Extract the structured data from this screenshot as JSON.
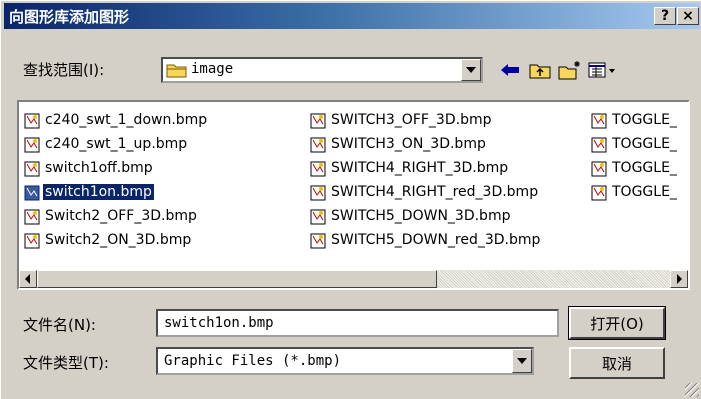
{
  "window": {
    "title": "向图形库添加图形",
    "help_label": "?",
    "close_label": "×"
  },
  "lookin": {
    "label": "查找范围(I):",
    "value": "image"
  },
  "files": {
    "column1": [
      "c240_swt_1_down.bmp",
      "c240_swt_1_up.bmp",
      "switch1off.bmp",
      "switch1on.bmp",
      "Switch2_OFF_3D.bmp",
      "Switch2_ON_3D.bmp"
    ],
    "column2": [
      "SWITCH3_OFF_3D.bmp",
      "SWITCH3_ON_3D.bmp",
      "SWITCH4_RIGHT_3D.bmp",
      "SWITCH4_RIGHT_red_3D.bmp",
      "SWITCH5_DOWN_3D.bmp",
      "SWITCH5_DOWN_red_3D.bmp"
    ],
    "column3": [
      "TOGGLE_",
      "TOGGLE_",
      "TOGGLE_",
      "TOGGLE_"
    ],
    "selected": "switch1on.bmp"
  },
  "filename": {
    "label": "文件名(N):",
    "value": "switch1on.bmp"
  },
  "filetype": {
    "label": "文件类型(T):",
    "value": "Graphic Files (*.bmp)"
  },
  "buttons": {
    "open": "打开(O)",
    "cancel": "取消"
  },
  "colors": {
    "titlebar_start": "#0a246a",
    "titlebar_end": "#a6caf0",
    "dialog_bg": "#d4d0c8",
    "selection": "#0a246a"
  }
}
